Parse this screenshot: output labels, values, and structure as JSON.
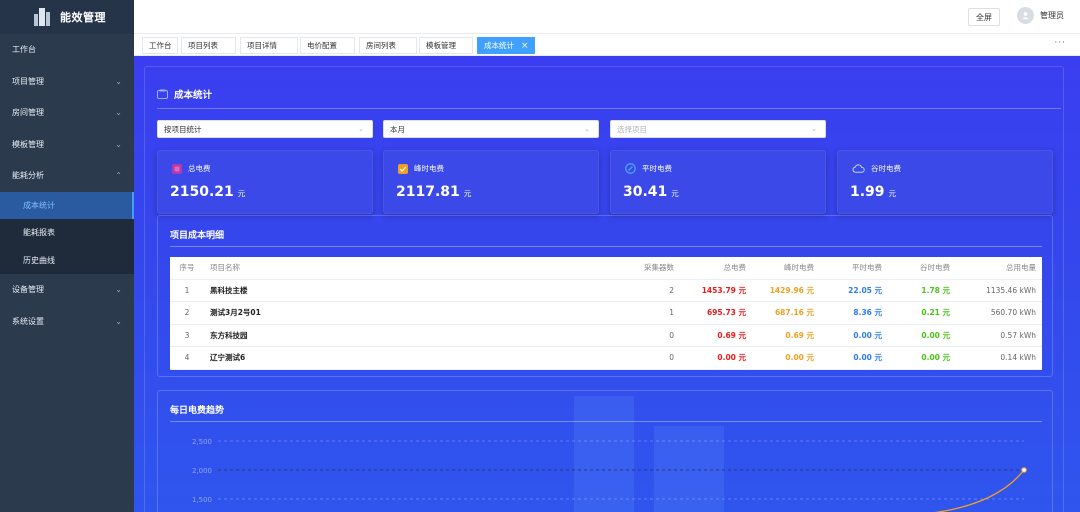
{
  "app": {
    "title": "能效管理"
  },
  "sidebar": {
    "items": [
      {
        "label": "工作台",
        "has_children": false
      },
      {
        "label": "项目管理",
        "has_children": true
      },
      {
        "label": "房间管理",
        "has_children": true
      },
      {
        "label": "模板管理",
        "has_children": true
      },
      {
        "label": "能耗分析",
        "has_children": true,
        "expanded": true,
        "children": [
          {
            "label": "成本统计",
            "active": true
          },
          {
            "label": "能耗报表"
          },
          {
            "label": "历史曲线"
          }
        ]
      },
      {
        "label": "设备管理",
        "has_children": true
      },
      {
        "label": "系统设置",
        "has_children": true
      }
    ]
  },
  "header": {
    "fullscreen_label": "全屏",
    "user_name": "管理员"
  },
  "tabs": [
    {
      "label": "工作台"
    },
    {
      "label": "项目列表"
    },
    {
      "label": "项目详情"
    },
    {
      "label": "电价配置"
    },
    {
      "label": "房间列表"
    },
    {
      "label": "模板管理"
    },
    {
      "label": "成本统计",
      "active": true,
      "close": "×"
    }
  ],
  "tabs_more": "···",
  "panel": {
    "title": "成本统计",
    "filters": {
      "mode": "按项目统计",
      "period": "本月",
      "project_placeholder": "选择项目"
    },
    "stats": [
      {
        "label": "总电费",
        "value": "2150.21",
        "unit": "元",
        "icon": "total-cost-icon",
        "color": "#c23fb5"
      },
      {
        "label": "峰时电费",
        "value": "2117.81",
        "unit": "元",
        "icon": "peak-check-icon",
        "color": "#f0a020"
      },
      {
        "label": "平时电费",
        "value": "30.41",
        "unit": "元",
        "icon": "flat-compass-icon",
        "color": "#2d7de8"
      },
      {
        "label": "谷时电费",
        "value": "1.99",
        "unit": "元",
        "icon": "valley-cloud-icon",
        "color": "#4bc218"
      }
    ],
    "detail": {
      "title": "项目成本明细",
      "columns": [
        "序号",
        "项目名称",
        "采集器数",
        "总电费",
        "峰时电费",
        "平时电费",
        "谷时电费",
        "总用电量"
      ],
      "rows": [
        [
          "1",
          "黑科技主楼",
          "2",
          "1453.79 元",
          "1429.96 元",
          "22.05 元",
          "1.78 元",
          "1135.46 kWh"
        ],
        [
          "2",
          "测试3月2号01",
          "1",
          "695.73 元",
          "687.16 元",
          "8.36 元",
          "0.21 元",
          "560.70 kWh"
        ],
        [
          "3",
          "东方科技园",
          "0",
          "0.69 元",
          "0.69 元",
          "0.00 元",
          "0.00 元",
          "0.57 kWh"
        ],
        [
          "4",
          "辽宁测试6",
          "0",
          "0.00 元",
          "0.00 元",
          "0.00 元",
          "0.00 元",
          "0.14 kWh"
        ]
      ]
    },
    "trend": {
      "title": "每日电费趋势"
    }
  },
  "chart_data": {
    "type": "line",
    "title": "每日电费趋势",
    "y_ticks": [
      "2,500",
      "2,000",
      "1,500"
    ],
    "ylim": [
      1000,
      2500
    ],
    "series": [
      {
        "values_visible_tail": [
          1250,
          2000
        ]
      }
    ],
    "grid": true,
    "line_color": "#f0a020"
  }
}
